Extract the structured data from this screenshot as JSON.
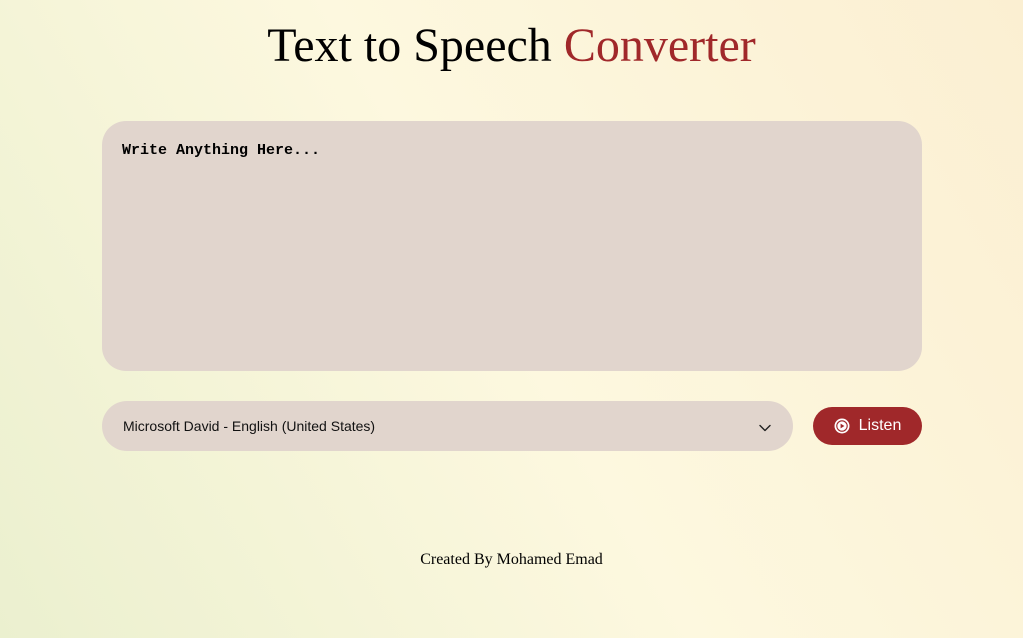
{
  "header": {
    "title_main": "Text to Speech",
    "title_accent": "Converter"
  },
  "text_input": {
    "placeholder": "Write Anything Here...",
    "value": ""
  },
  "voice_select": {
    "selected": "Microsoft David - English (United States)",
    "icon": "chevron-down-icon"
  },
  "listen_button": {
    "label": "Listen",
    "icon": "play-circle-icon"
  },
  "footer": {
    "credit": "Created By Mohamed Emad"
  },
  "colors": {
    "accent": "#a0282a",
    "panel": "#e1d5cd",
    "background_start": "#ebf0cf",
    "background_end": "#fbefd2"
  }
}
